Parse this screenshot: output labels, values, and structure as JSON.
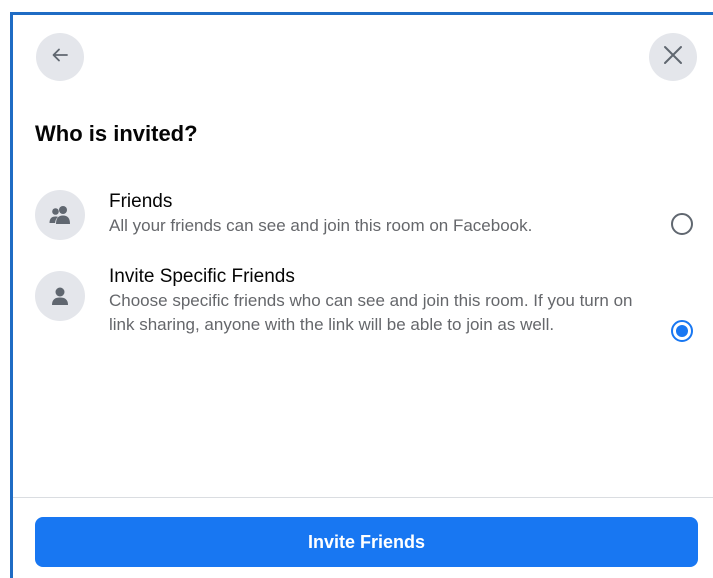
{
  "dialog": {
    "back_icon": "arrow-left-icon",
    "close_icon": "close-icon",
    "title": "Who is invited?"
  },
  "options": [
    {
      "icon": "friends-group-icon",
      "label": "Friends",
      "description": "All your friends can see and join this room on Facebook.",
      "selected": false
    },
    {
      "icon": "person-icon",
      "label": "Invite Specific Friends",
      "description": "Choose specific friends who can see and join this room. If you turn on link sharing, anyone with the link will be able to join as well.",
      "selected": true
    }
  ],
  "footer": {
    "button_label": "Invite Friends"
  },
  "colors": {
    "accent": "#1877f2",
    "icon_background": "#e4e6eb",
    "secondary_text": "#65676b",
    "frame_border": "#1f6cc4"
  }
}
